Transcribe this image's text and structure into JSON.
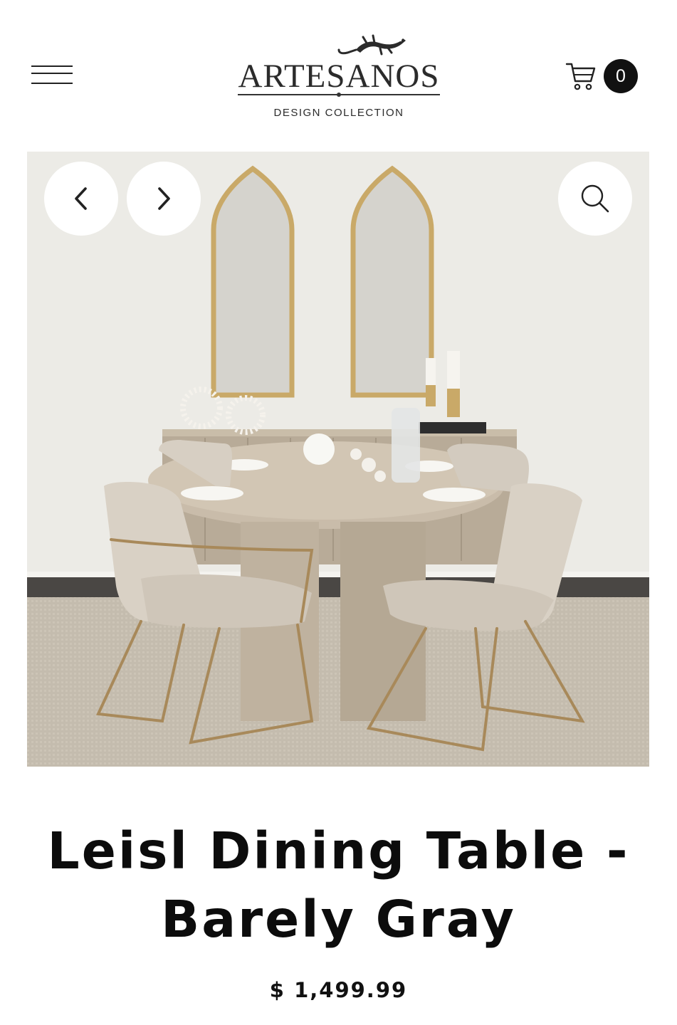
{
  "header": {
    "brand": "ARTESANOS",
    "tagline": "DESIGN COLLECTION",
    "cart_count": "0",
    "menu_icon": "hamburger-menu-icon",
    "cart_icon": "shopping-cart-icon"
  },
  "gallery": {
    "prev_icon": "chevron-left-icon",
    "next_icon": "chevron-right-icon",
    "zoom_icon": "search-icon",
    "image_alt": "Leisl Dining Table - Barely Gray"
  },
  "product": {
    "title": "Leisl Dining Table - Barely Gray",
    "price": "$ 1,499.99"
  }
}
